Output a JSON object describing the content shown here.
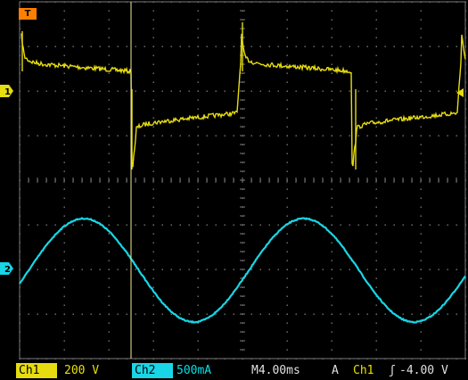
{
  "colors": {
    "ch1": "#e6dc10",
    "ch2": "#18d6e6",
    "grid": "#7a7a7a",
    "trigger": "#ff7f00",
    "background": "#000000"
  },
  "markers": {
    "trigger": "T",
    "ch1": "1",
    "ch2": "2"
  },
  "icons": {
    "trigger_marker": "trigger-position-icon",
    "slope": "rising-edge-icon"
  },
  "status": {
    "ch1_label": "Ch1",
    "ch1_scale": "200 V",
    "ch2_label": "Ch2",
    "ch2_scale": "500mA",
    "timebase": "M4.00ms",
    "trigger_mode": "A",
    "trigger_source": "Ch1",
    "trigger_slope": "ʃ",
    "trigger_level": "-4.00 V"
  }
}
